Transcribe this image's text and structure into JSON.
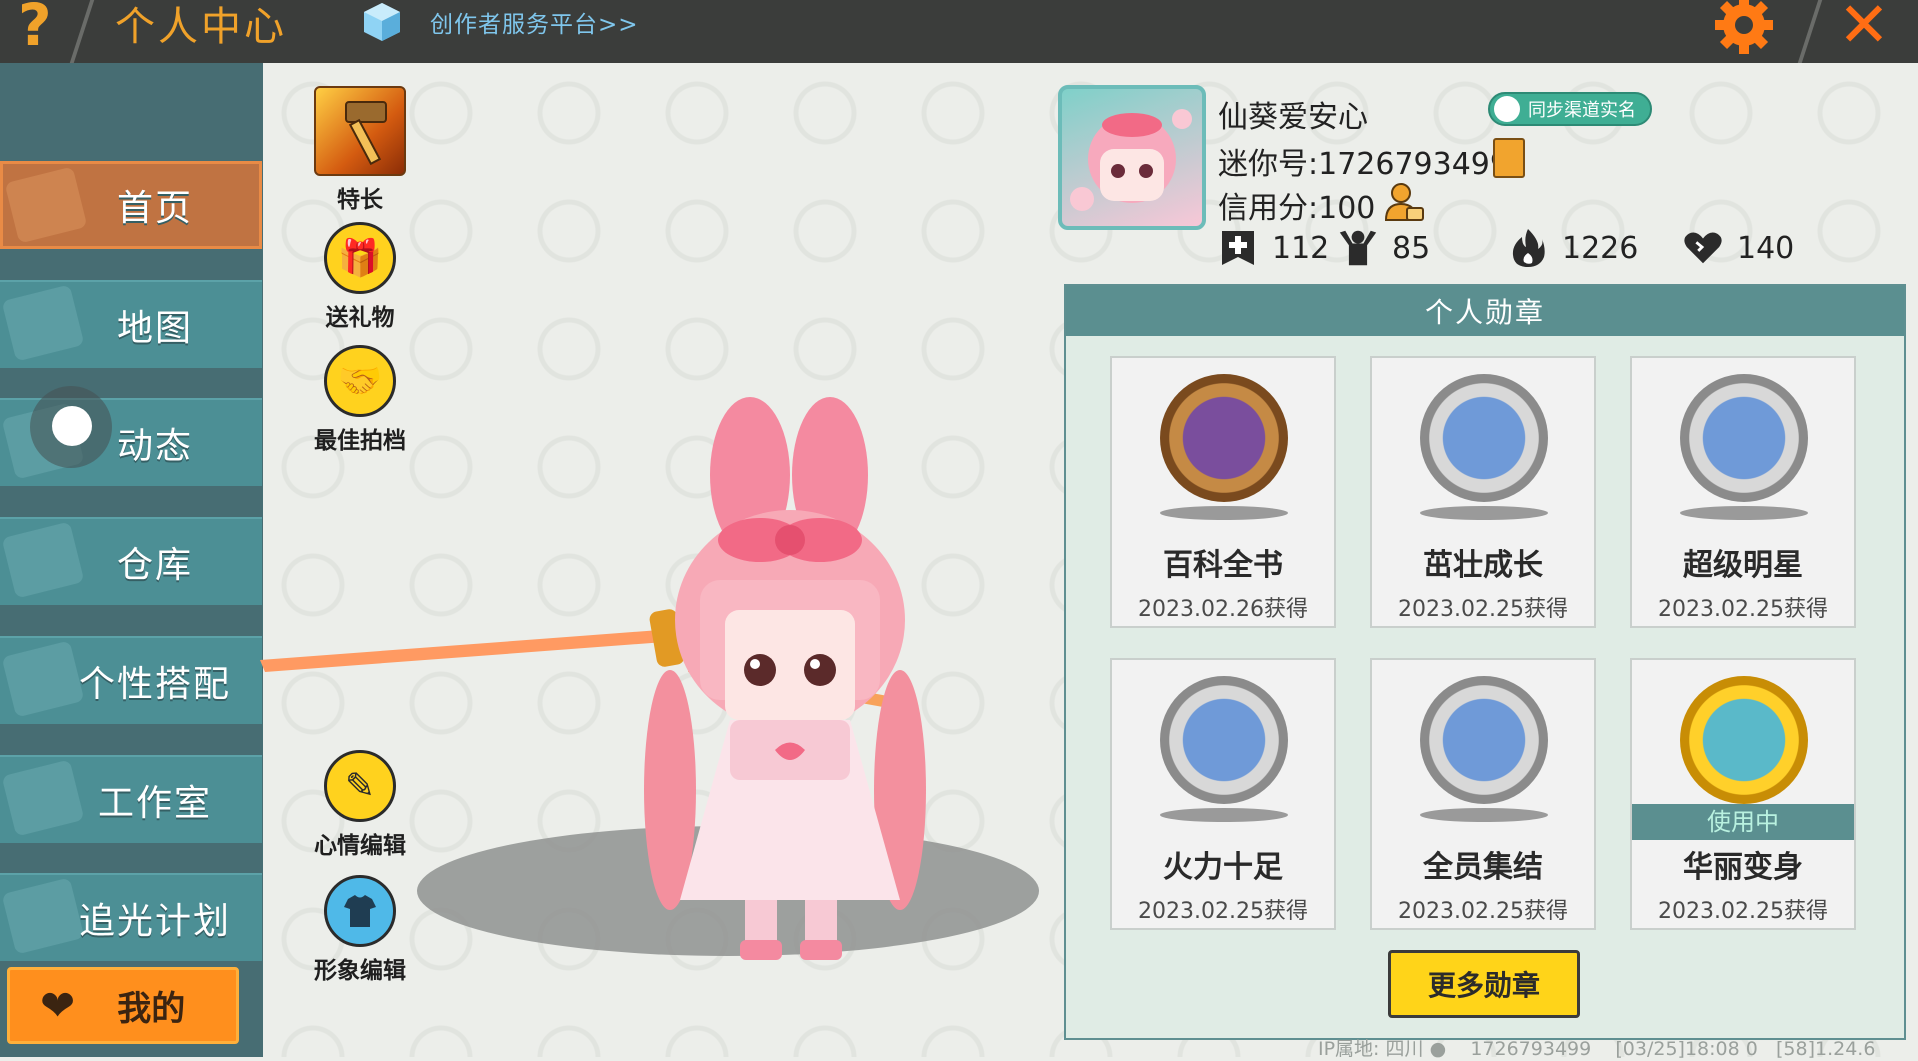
{
  "topbar": {
    "title": "个人中心",
    "creator_link": "创作者服务平台>>"
  },
  "sidebar": {
    "items": [
      {
        "label": "首页",
        "active": true
      },
      {
        "label": "地图"
      },
      {
        "label": "动态"
      },
      {
        "label": "仓库"
      },
      {
        "label": "个性搭配"
      },
      {
        "label": "工作室"
      },
      {
        "label": "追光计划"
      }
    ],
    "mine_label": "我的"
  },
  "actions": {
    "specialty": "特长",
    "gift": "送礼物",
    "partner": "最佳拍档",
    "mood": "心情编辑",
    "avatar_edit": "形象编辑"
  },
  "profile": {
    "name": "仙葵爱安心",
    "verify": "同步渠道实名",
    "mini_id": "迷你号:1726793499",
    "credit": "信用分:100",
    "stats": [
      "112",
      "85",
      "1226",
      "140"
    ]
  },
  "medals": {
    "title": "个人勋章",
    "cards": [
      {
        "name": "百科全书",
        "date": "2023.02.26获得",
        "style": "bronze"
      },
      {
        "name": "茁壮成长",
        "date": "2023.02.25获得",
        "style": "silver"
      },
      {
        "name": "超级明星",
        "date": "2023.02.25获得",
        "style": "silver"
      },
      {
        "name": "火力十足",
        "date": "2023.02.25获得",
        "style": "silver"
      },
      {
        "name": "全员集结",
        "date": "2023.02.25获得",
        "style": "silver"
      },
      {
        "name": "华丽变身",
        "date": "2023.02.25获得",
        "style": "gold",
        "in_use": "使用中"
      }
    ],
    "more": "更多勋章"
  },
  "footer": {
    "ip": "IP属地: 四川",
    "uid": "1726793499",
    "timestamp": "[03/25]18:08 0",
    "version": "[58]1.24.6"
  },
  "colors": {
    "topbar": "#3b3d3b",
    "accent_orange": "#f0a22a",
    "sidebar": "#4c8f95",
    "medal_header": "#5b8f90",
    "gold_button": "#ffd419"
  }
}
